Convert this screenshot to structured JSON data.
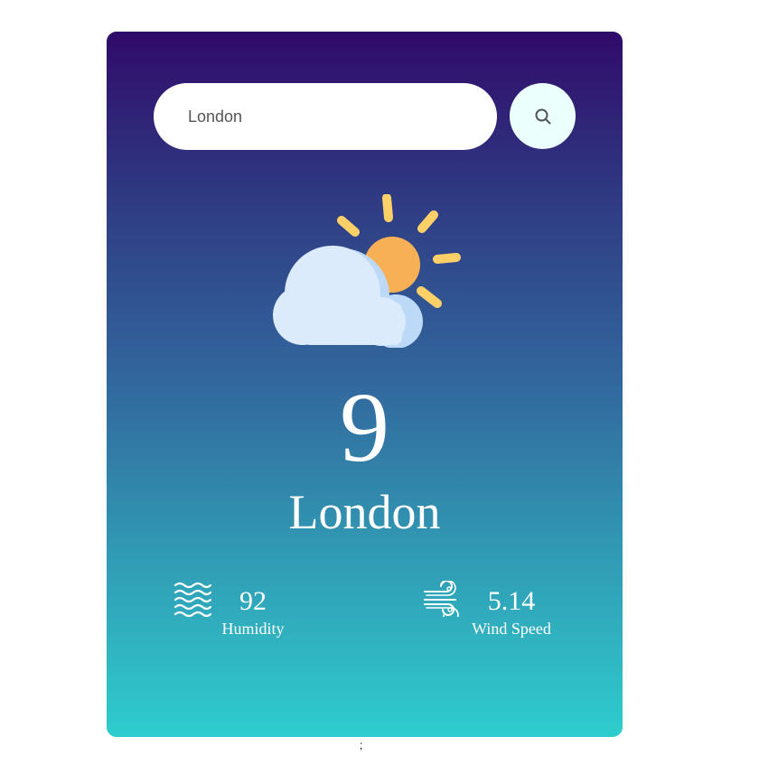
{
  "search": {
    "value": "London",
    "button_icon": "search-icon"
  },
  "weather": {
    "icon": "partly-cloudy-icon",
    "temperature": "9",
    "city": "London"
  },
  "stats": {
    "humidity": {
      "value": "92",
      "label": "Humidity",
      "icon": "humidity-waves-icon"
    },
    "wind": {
      "value": "5.14",
      "label": "Wind Speed",
      "icon": "wind-icon"
    }
  },
  "footer": {
    "mark": ";"
  },
  "colors": {
    "gradient_top": "#300b6a",
    "gradient_bottom": "#2ecdce",
    "search_button_bg": "#ebfffc",
    "sun": "#f7b055",
    "sun_rays": "#fdd068",
    "cloud": "#dbebfc",
    "cloud_shadow": "#bcd9f7"
  }
}
